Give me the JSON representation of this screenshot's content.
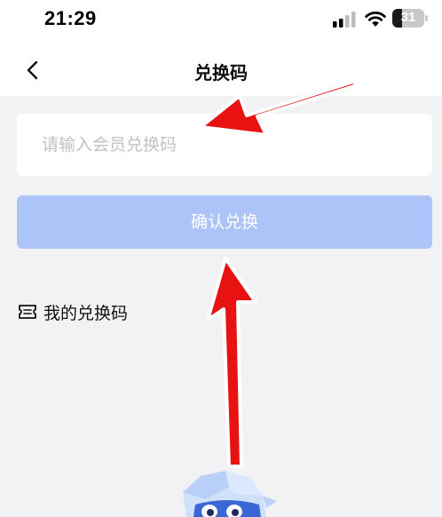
{
  "status_bar": {
    "time": "21:29",
    "battery_level": "31",
    "battery_fraction": 0.31
  },
  "nav": {
    "title": "兑换码",
    "back_icon": "chevron-left-icon"
  },
  "form": {
    "code_input_placeholder": "请输入会员兑换码",
    "code_input_value": "",
    "confirm_label": "确认兑换"
  },
  "links": {
    "my_codes_label": "我的兑换码",
    "my_codes_icon": "ticket-icon"
  },
  "colors": {
    "page_background": "#f2f2f4",
    "confirm_button_disabled": "#adc4f8",
    "annotation_arrow": "#e81212"
  }
}
